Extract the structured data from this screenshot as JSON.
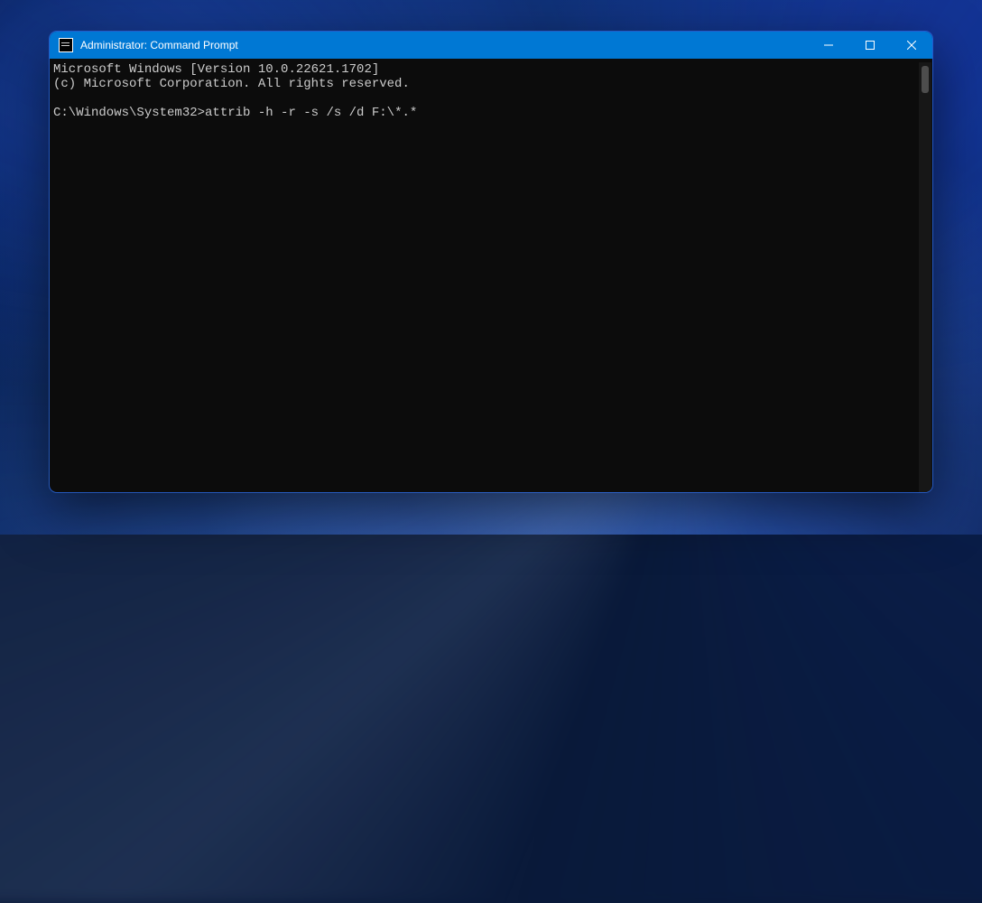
{
  "window": {
    "title": "Administrator: Command Prompt"
  },
  "terminal": {
    "line1": "Microsoft Windows [Version 10.0.22621.1702]",
    "line2": "(c) Microsoft Corporation. All rights reserved.",
    "blank": "",
    "prompt": "C:\\Windows\\System32>",
    "command": "attrib -h -r -s /s /d F:\\*.*"
  }
}
